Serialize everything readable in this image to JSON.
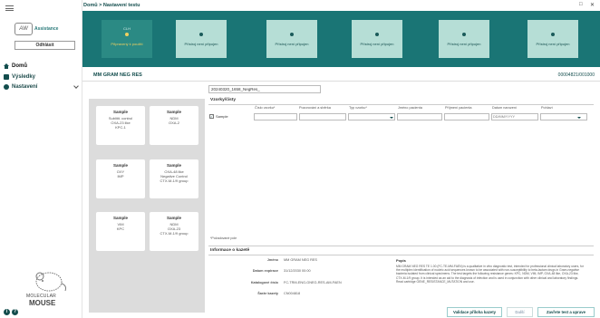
{
  "sidebar": {
    "assistance_label": "Assistance",
    "assistance_logo": "AW",
    "logout_label": "Odhlásit",
    "nav": [
      {
        "label": "Domů",
        "icon": "home-icon"
      },
      {
        "label": "Výsledky",
        "icon": "results-icon"
      },
      {
        "label": "Nastavení",
        "icon": "gear-icon"
      }
    ],
    "logo_line1": "MOLECULAR",
    "logo_line2": "MOUSE",
    "footer_icons": [
      "info-icon",
      "help-icon"
    ]
  },
  "topbar": {
    "breadcrumb": "Domů > Nastavení testu",
    "minimize": "□",
    "close": "✕"
  },
  "steps": [
    {
      "caption": "CLH",
      "label": "Připravený k použití",
      "active": true
    },
    {
      "caption": "",
      "label": "Přístroj není připojen",
      "active": false
    },
    {
      "caption": "",
      "label": "Přístroj není připojen",
      "active": false
    },
    {
      "caption": "",
      "label": "Přístroj není připojen",
      "active": false
    },
    {
      "caption": "",
      "label": "Přístroj není připojen",
      "active": false
    },
    {
      "caption": "",
      "label": "Přístroj není připojen",
      "active": false
    }
  ],
  "main": {
    "cassette_name": "MM GRAM NEG RES",
    "cassette_code": "00004821/001000",
    "run_name": "20240320_1658_NegRes_",
    "wells": [
      {
        "title": "Sample",
        "lines": [
          "Sublitit. control",
          "OXA-23 like",
          "KPC-1"
        ]
      },
      {
        "title": "Sample",
        "lines": [
          "NDM",
          "OXA-2"
        ]
      },
      {
        "title": "Sample",
        "lines": [
          "OXY",
          "IMP"
        ]
      },
      {
        "title": "Sample",
        "lines": [
          "OXA-48 like",
          "Negative Control",
          "CTX-M-1/9 group"
        ]
      },
      {
        "title": "Sample",
        "lines": [
          "VIM",
          "KPC"
        ]
      },
      {
        "title": "Sample",
        "lines": [
          "NDM",
          "OXA-23",
          "CTX-M-1/9 group"
        ]
      }
    ],
    "samples_title": "Vzorky/čísty",
    "columns": [
      "Číslo vzorku*",
      "Pozorování a sběrka",
      "Typ vzorku*",
      "Jméno pacienta",
      "Příjmení pacienta",
      "Datum narození",
      "Pohlaví"
    ],
    "row_label": "Sample",
    "dob_placeholder": "DD/MM/YYYY",
    "required_note": "*Požadované pole",
    "info_title": "Informace o kazetě",
    "info": [
      {
        "key": "Jméno",
        "value": "MM GRAM NEG RES"
      },
      {
        "key": "Datum expirace",
        "value": "31/12/2030 00:00"
      },
      {
        "key": "Katalogové číslo",
        "value": "FC-TRM-ENG-GNEG-RES-AM-FAEN"
      },
      {
        "key": "Šarže kazety",
        "value": "CN004818"
      }
    ],
    "description_title": "Popis",
    "description": "MM GRAM NEG RES TE 1.00 (FC-TE-MM-FAEN) is a qualitative in vitro diagnostic test, intended for professional clinical laboratory users, for the multiplex identification of nucleic acid sequences known to be associated with non-susceptibility to beta-lactam drugs in Gram-negative bacteria isolated from clinical specimens. The test targets the following resistance genes: KPC, NDM, VIM, IMP, OXA-48 like, OXA-23 like, CTX-M-1/9 group. It is intended as an aid to the diagnosis of infection and is used in conjunction with other clinical and laboratory findings. Read cartridge GENE_RESISTANCE_MUTATION and use.",
    "buttons": {
      "validate": "Validace příloha kazety",
      "next": "Další",
      "close_save": "Zavřete test a uprave"
    }
  }
}
